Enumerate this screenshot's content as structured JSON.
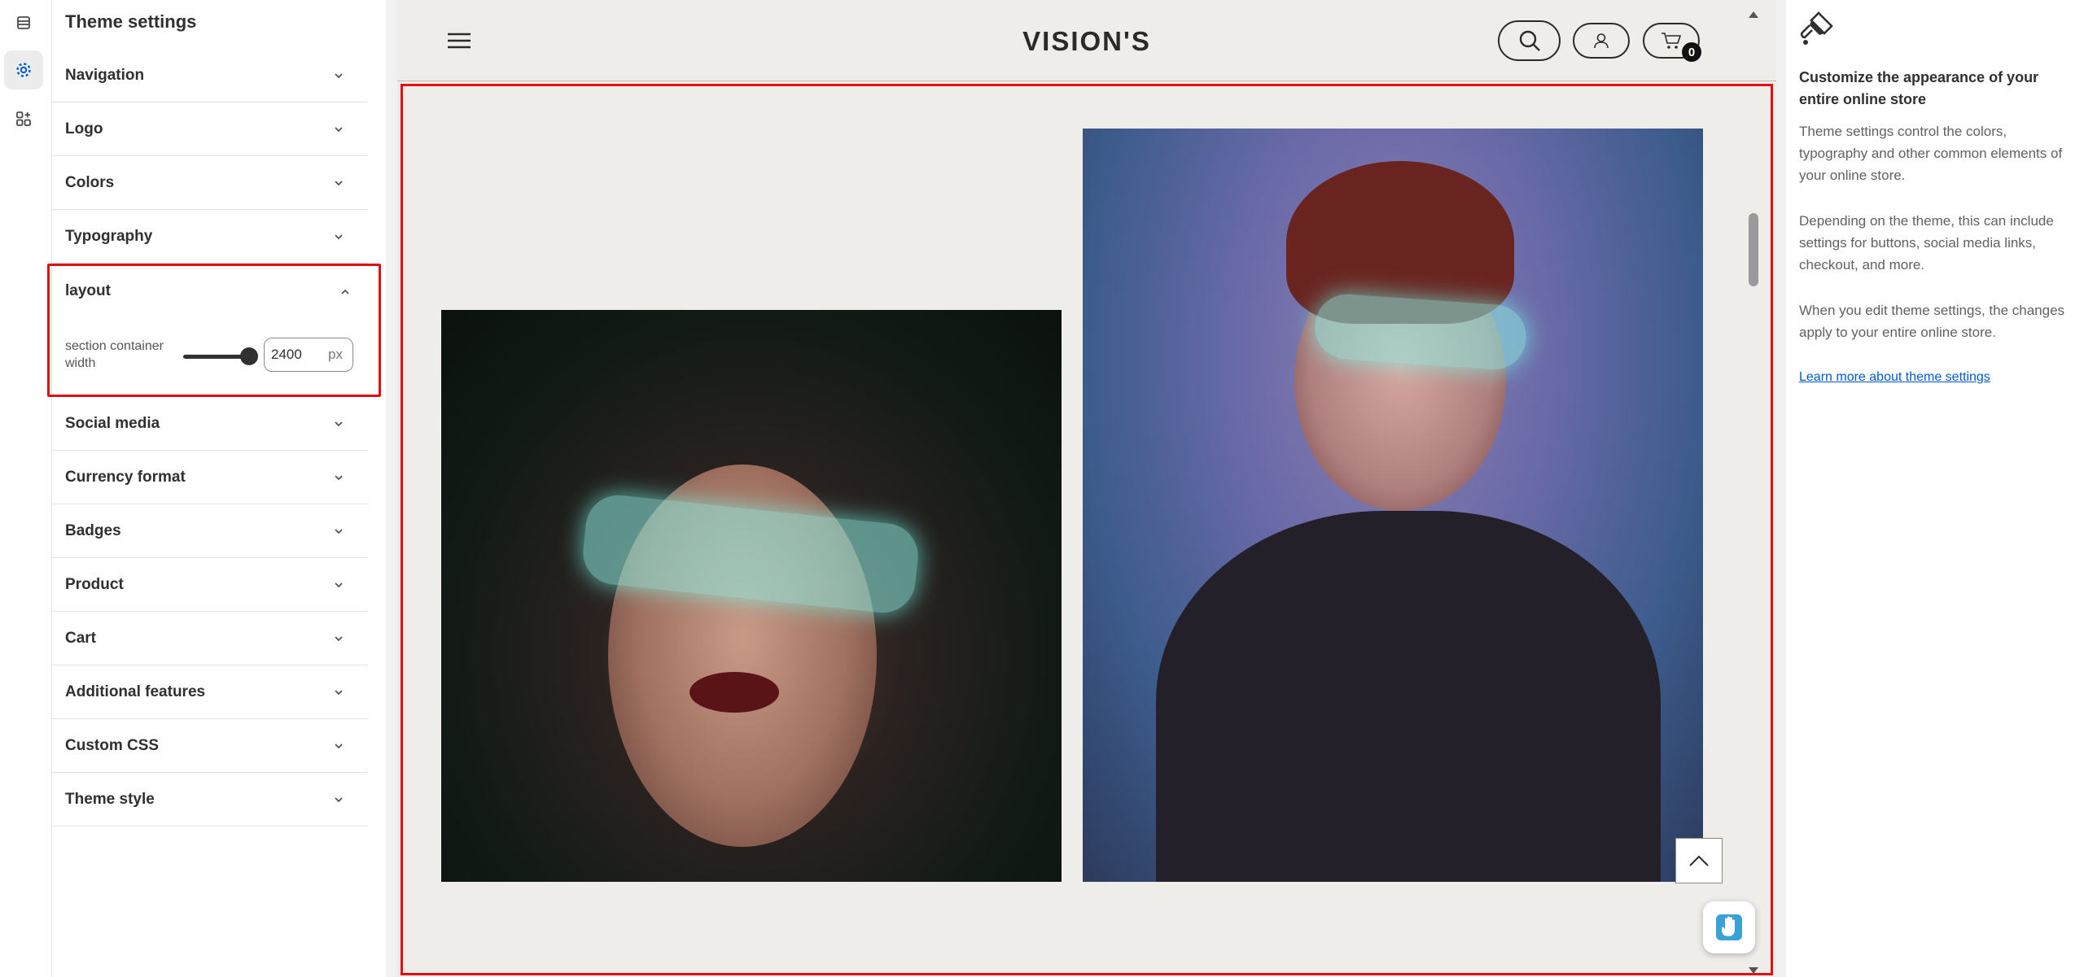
{
  "panel": {
    "title": "Theme settings",
    "items": [
      {
        "label": "Navigation"
      },
      {
        "label": "Logo"
      },
      {
        "label": "Colors"
      },
      {
        "label": "Typography"
      }
    ],
    "layout": {
      "label": "layout",
      "field_label": "section container width",
      "slider_fraction": 1.0,
      "value": "2400",
      "unit": "px"
    },
    "items_after": [
      {
        "label": "Social media"
      },
      {
        "label": "Currency format"
      },
      {
        "label": "Badges"
      },
      {
        "label": "Product"
      },
      {
        "label": "Cart"
      },
      {
        "label": "Additional features"
      },
      {
        "label": "Custom CSS"
      },
      {
        "label": "Theme style"
      }
    ]
  },
  "store": {
    "brand": "VISION'S",
    "cart_count": "0"
  },
  "info": {
    "heading": "Customize the appearance of your entire online store",
    "p1": "Theme settings control the colors, typography and other common elements of your online store.",
    "p2": "Depending on the theme, this can include settings for buttons, social media links, checkout, and more.",
    "p3": "When you edit theme settings, the changes apply to your entire online store.",
    "link": "Learn more about theme settings"
  },
  "colors": {
    "highlight": "#e01010",
    "link": "#005bd3",
    "accent": "#005bd3"
  }
}
